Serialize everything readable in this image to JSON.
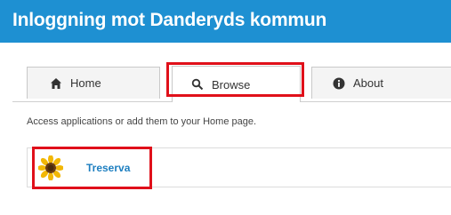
{
  "header": {
    "title": "Inloggning mot Danderyds kommun"
  },
  "tabs": [
    {
      "label": "Home",
      "icon": "home-icon",
      "active": false
    },
    {
      "label": "Browse",
      "icon": "search-icon",
      "active": true
    },
    {
      "label": "About",
      "icon": "info-icon",
      "active": false
    }
  ],
  "main": {
    "intro": "Access applications or add them to your Home page."
  },
  "apps": [
    {
      "label": "Treserva",
      "icon": "sunflower-icon"
    }
  ],
  "colors": {
    "header_bg": "#1e90d2",
    "highlight": "#e0101a",
    "app_link": "#1e7fc0"
  }
}
